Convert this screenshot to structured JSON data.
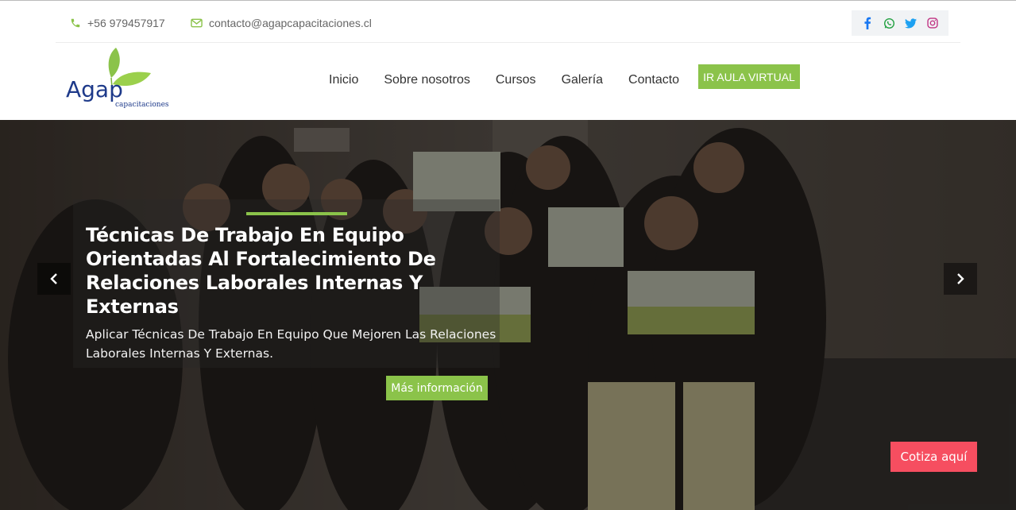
{
  "topbar": {
    "phone": "+56 979457917",
    "email": "contacto@agapcapacitaciones.cl",
    "phone_icon": "phone-icon",
    "mail_icon": "envelope-icon",
    "social": [
      {
        "name": "facebook-icon",
        "color": "#1877f2"
      },
      {
        "name": "whatsapp-icon",
        "color": "#25a244"
      },
      {
        "name": "twitter-icon",
        "color": "#1da1f2"
      },
      {
        "name": "instagram-icon",
        "color": "#c13584"
      }
    ],
    "accent_color": "#8bc34a"
  },
  "logo": {
    "wordmark": "Agap",
    "subtext": "capacitaciones",
    "brand_color": "#1e3a8a"
  },
  "nav": {
    "items": [
      "Inicio",
      "Sobre nosotros",
      "Cursos",
      "Galería",
      "Contacto"
    ],
    "cta": "IR AULA VIRTUAL"
  },
  "slide": {
    "title": "Técnicas De Trabajo En Equipo Orientadas Al Fortalecimiento De Relaciones Laborales Internas Y Externas",
    "description": "Aplicar Técnicas De Trabajo En Equipo Que Mejoren Las Relaciones Laborales Internas Y Externas.",
    "button": "Más información",
    "prev_icon": "chevron-left-icon",
    "next_icon": "chevron-right-icon"
  },
  "floating": {
    "cotiza": "Cotiza aquí",
    "color": "#f64e60"
  }
}
